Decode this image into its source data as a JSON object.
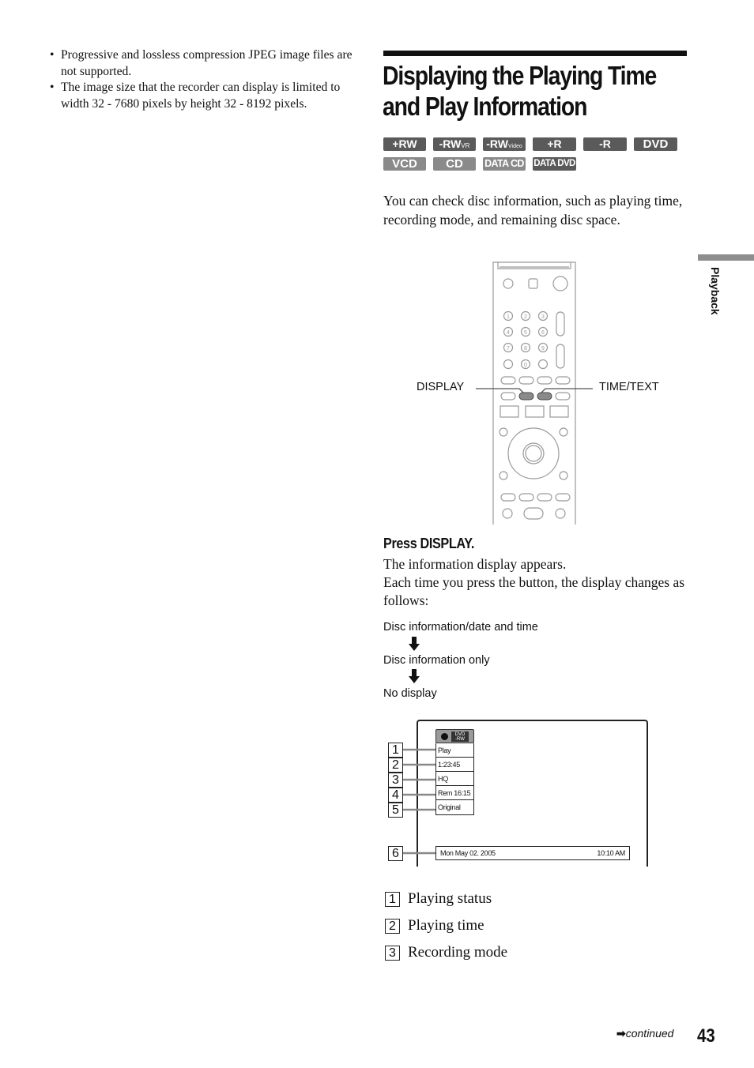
{
  "left_column": {
    "bullets": [
      "Progressive and lossless compression JPEG image files are not supported.",
      "The image size that the recorder can display is limited to width 32 - 7680 pixels by height 32 - 8192 pixels."
    ]
  },
  "heading": {
    "title_line1": "Displaying the Playing Time",
    "title_line2": "and Play Information"
  },
  "disc_badges": [
    {
      "label": "+RW",
      "sub": "",
      "tone": "dark"
    },
    {
      "label": "-RW",
      "sub": "VR",
      "tone": "dark"
    },
    {
      "label": "-RW",
      "sub": "Video",
      "tone": "dark"
    },
    {
      "label": "+R",
      "sub": "",
      "tone": "dark"
    },
    {
      "label": "-R",
      "sub": "",
      "tone": "dark"
    },
    {
      "label": "DVD",
      "sub": "",
      "tone": "dark"
    },
    {
      "label": "VCD",
      "sub": "",
      "tone": "light"
    },
    {
      "label": "CD",
      "sub": "",
      "tone": "light"
    },
    {
      "label": "DATA CD",
      "sub": "",
      "tone": "light"
    },
    {
      "label": "DATA DVD",
      "sub": "",
      "tone": "dark"
    }
  ],
  "intro": "You can check disc information, such as playing time, recording mode, and remaining disc space.",
  "side_tab": "Playback",
  "remote": {
    "left_label": "DISPLAY",
    "right_label": "TIME/TEXT"
  },
  "step": {
    "title": "Press DISPLAY.",
    "line1": "The information display appears.",
    "line2": "Each time you press the button, the display changes as follows:"
  },
  "sequence": [
    "Disc information/date and time",
    "Disc information only",
    "No display"
  ],
  "display_screen": {
    "disc_type_top": "DVD",
    "disc_type_bottom": "-RW",
    "rows": [
      "Play",
      "1:23:45",
      "HQ",
      "Rem 16:15",
      "Original"
    ],
    "date": "Mon  May  02. 2005",
    "time": "10:10 AM",
    "callouts": [
      "1",
      "2",
      "3",
      "4",
      "5",
      "6"
    ]
  },
  "legend": [
    {
      "num": "1",
      "text": "Playing status"
    },
    {
      "num": "2",
      "text": "Playing time"
    },
    {
      "num": "3",
      "text": "Recording mode"
    }
  ],
  "footer": {
    "continued": "continued",
    "page_number": "43"
  }
}
